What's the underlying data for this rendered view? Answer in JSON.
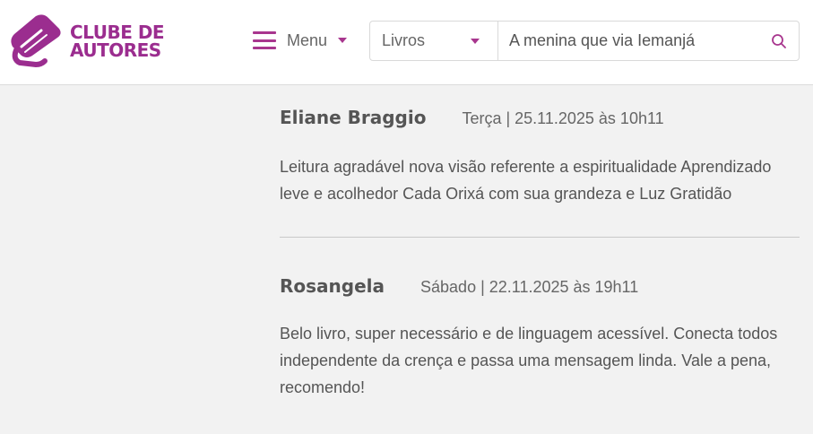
{
  "header": {
    "logo": {
      "line1": "CLUBE DE",
      "line2": "AUTORES"
    },
    "menu_label": "Menu",
    "search": {
      "category": "Livros",
      "query": "A menina que via Iemanjá"
    }
  },
  "reviews": [
    {
      "name": "Eliane Braggio",
      "date": "Terça | 25.11.2025 às 10h11",
      "text": "Leitura agradável nova visão referente a espiritualidade Aprendizado leve e acolhedor Cada Orixá com sua grandeza e Luz Gratidão"
    },
    {
      "name": "Rosangela",
      "date": "Sábado | 22.11.2025 às 19h11",
      "text": "Belo livro, super necessário e de linguagem acessível. Conecta todos independente da crença e passa uma mensagem linda. Vale a pena, recomendo!"
    }
  ],
  "colors": {
    "brand": "#9b2d8f",
    "accent": "#a8368e",
    "background": "#f2f2f2"
  }
}
